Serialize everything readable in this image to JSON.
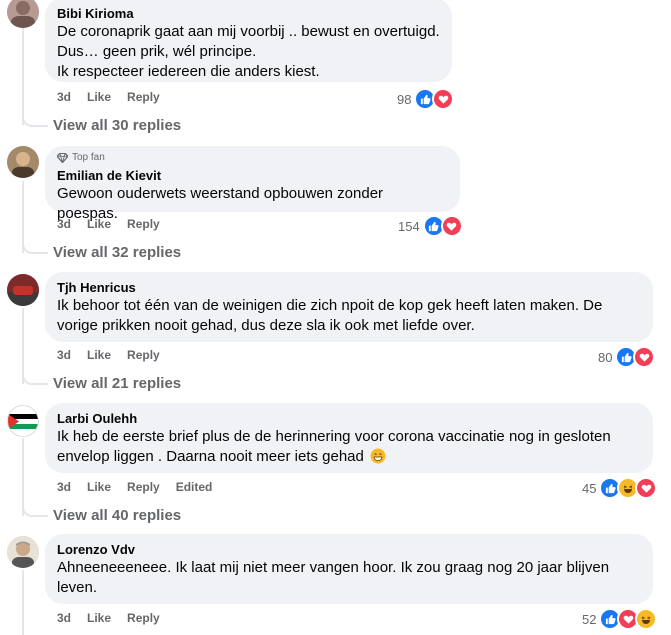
{
  "comments": [
    {
      "author": "Bibi Kirioma",
      "lines": [
        "De coronaprik gaat aan mij voorbij .. bewust en overtuigd.",
        "Dus… geen prik, wél principe.",
        "Ik respecteer iedereen die anders kiest."
      ],
      "time": "3d",
      "like": "Like",
      "reply": "Reply",
      "reactions": "98",
      "view_replies": "View all 30 replies"
    },
    {
      "badge": "Top fan",
      "author": "Emilian de Kievit",
      "lines": [
        "Gewoon ouderwets weerstand opbouwen zonder poespas."
      ],
      "time": "3d",
      "like": "Like",
      "reply": "Reply",
      "reactions": "154",
      "view_replies": "View all 32 replies"
    },
    {
      "author": "Tjh Henricus",
      "lines": [
        "Ik behoor tot één van de weinigen die zich npoit de kop gek heeft laten maken. De",
        "vorige prikken nooit gehad, dus deze sla ik ook met liefde over."
      ],
      "time": "3d",
      "like": "Like",
      "reply": "Reply",
      "reactions": "80",
      "view_replies": "View all 21 replies"
    },
    {
      "author": "Larbi Oulehh",
      "lines": [
        "Ik heb de eerste brief plus de de herinnering voor corona vaccinatie nog in gesloten",
        "envelop liggen . Daarna nooit meer iets gehad"
      ],
      "time": "3d",
      "like": "Like",
      "reply": "Reply",
      "edited": "Edited",
      "reactions": "45",
      "view_replies": "View all 40 replies"
    },
    {
      "author": "Lorenzo Vdv",
      "lines": [
        "Ahneeneeeneee. Ik laat mij niet meer vangen hoor. Ik zou graag nog 20 jaar blijven",
        "leven."
      ],
      "time": "3d",
      "like": "Like",
      "reply": "Reply",
      "reactions": "52"
    }
  ],
  "colors": {
    "like": "#1877f2",
    "love": "#f33e58",
    "haha": "#f7b928",
    "bubble": "#f0f2f5",
    "meta": "#65676b"
  }
}
